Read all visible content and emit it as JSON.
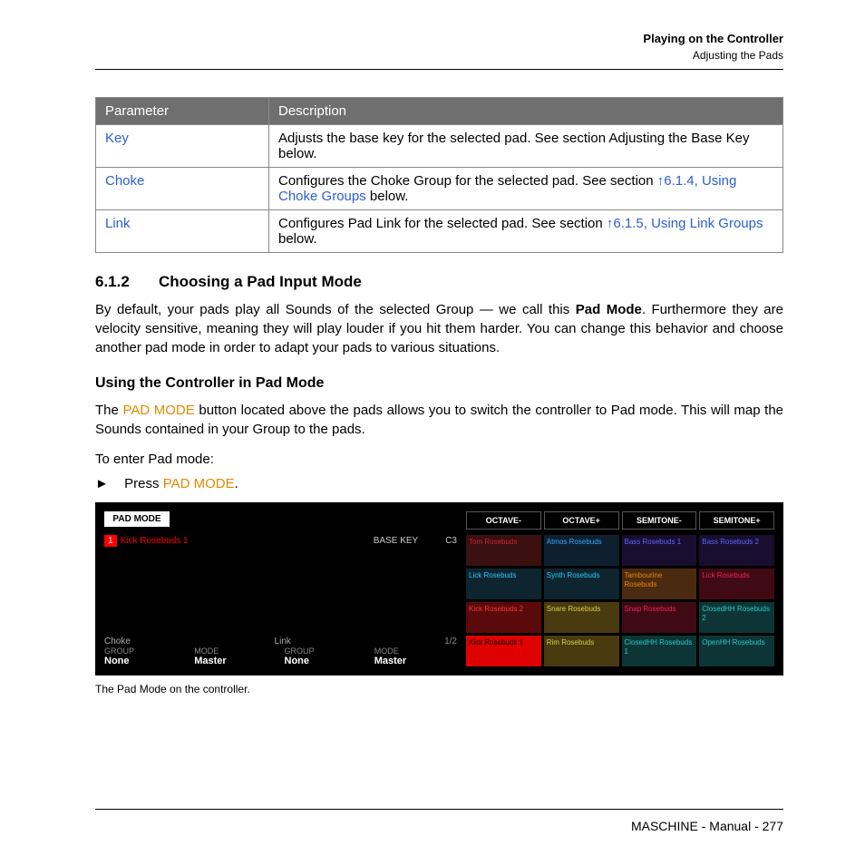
{
  "header": {
    "title": "Playing on the Controller",
    "subtitle": "Adjusting the Pads"
  },
  "table": {
    "th1": "Parameter",
    "th2": "Description",
    "rows": [
      {
        "p": "Key",
        "d1": "Adjusts the base key for the selected pad. See section Adjusting the Base Key below.",
        "link": ""
      },
      {
        "p": "Choke",
        "d1": "Configures the Choke Group for the selected pad. See section ",
        "link": "↑6.1.4, Using Choke Groups",
        "d2": " below."
      },
      {
        "p": "Link",
        "d1": "Configures Pad Link for the selected pad. See section ",
        "link": "↑6.1.5, Using Link Groups",
        "d2": " below."
      }
    ]
  },
  "sec": {
    "num": "6.1.2",
    "title": "Choosing a Pad Input Mode"
  },
  "para1a": "By default, your pads play all Sounds of the selected Group — we call this ",
  "para1b": "Pad Mode",
  "para1c": ". Furthermore they are velocity sensitive, meaning they will play louder if you hit them harder. You can change this behavior and choose another pad mode in order to adapt your pads to various situations.",
  "sub": "Using the Controller in Pad Mode",
  "para2a": "The ",
  "para2b": "PAD MODE",
  "para2c": " button located above the pads allows you to switch the controller to Pad mode. This will map the Sounds contained in your Group to the pads.",
  "instr": "To enter Pad mode:",
  "step_pre": "Press ",
  "step_btn": "PAD MODE",
  "step_post": ".",
  "ctrl": {
    "pm": "PAD MODE",
    "slot": "1",
    "name": "Kick Rosebuds 1",
    "bk": "BASE KEY",
    "bkv": "C3",
    "p1": "Choke",
    "p2": "Link",
    "page": "1/2",
    "g": "GROUP",
    "m": "MODE",
    "none": "None",
    "master": "Master",
    "btns": [
      "OCTAVE-",
      "OCTAVE+",
      "SEMITONE-",
      "SEMITONE+"
    ],
    "pads": [
      {
        "t": "Tom Rosebuds",
        "bg": "#3a1010",
        "c": "#c23"
      },
      {
        "t": "Atmos Rosebuds",
        "bg": "#0e2030",
        "c": "#3af"
      },
      {
        "t": "Bass Rosebuds 1",
        "bg": "#1a0e30",
        "c": "#56f"
      },
      {
        "t": "Bass Rosebuds 2",
        "bg": "#1a0e30",
        "c": "#56f"
      },
      {
        "t": "Lick Rosebuds",
        "bg": "#0e2530",
        "c": "#2cf"
      },
      {
        "t": "Synth Rosebuds",
        "bg": "#0e2530",
        "c": "#2cf"
      },
      {
        "t": "Tambourine Rosebuds",
        "bg": "#4a2a10",
        "c": "#e80"
      },
      {
        "t": "Lick Rosebuds",
        "bg": "#400a15",
        "c": "#e25"
      },
      {
        "t": "Kick Rosebuds 2",
        "bg": "#5a0a0a",
        "c": "#f33"
      },
      {
        "t": "Snare Rosebuds",
        "bg": "#4a3a10",
        "c": "#dc4"
      },
      {
        "t": "Snap Rosebuds",
        "bg": "#400a15",
        "c": "#e25"
      },
      {
        "t": "ClosedHH Rosebuds 2",
        "bg": "#0e3535",
        "c": "#2cc"
      },
      {
        "t": "Kick Rosebuds 1",
        "bg": "#e00000",
        "c": "#000"
      },
      {
        "t": "Rim Rosebuds",
        "bg": "#4a3a10",
        "c": "#dc4"
      },
      {
        "t": "ClosedHH Rosebuds 1",
        "bg": "#0e3535",
        "c": "#2cc"
      },
      {
        "t": "OpenHH Rosebuds",
        "bg": "#0e3535",
        "c": "#2cc"
      }
    ]
  },
  "caption": "The Pad Mode on the controller.",
  "footer": "MASCHINE - Manual - 277"
}
